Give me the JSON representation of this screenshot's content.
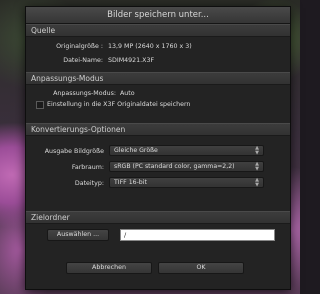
{
  "dialog": {
    "title": "Bilder speichern unter..."
  },
  "quelle": {
    "header": "Quelle",
    "size_label": "Originalgröße :",
    "size_value": "13,9 MP (2640 x 1760 x 3)",
    "filename_label": "Datei-Name:",
    "filename_value": "SDIM4921.X3F"
  },
  "anpassung": {
    "header": "Anpassungs-Modus",
    "mode_label": "Anpassungs-Modus:",
    "mode_value": "Auto",
    "checkbox_label": "Einstellung in die X3F Originaldatei speichern"
  },
  "konvertierung": {
    "header": "Konvertierungs-Optionen",
    "size_label": "Ausgabe Bildgröße",
    "size_value": "Gleiche Größe",
    "colorspace_label": "Farbraum:",
    "colorspace_value": "sRGB (PC standard color, gamma=2,2)",
    "filetype_label": "Dateityp:",
    "filetype_value": "TIFF 16-bit"
  },
  "zielordner": {
    "header": "Zielordner",
    "browse_label": "Auswählen ...",
    "path_value": "/"
  },
  "footer": {
    "cancel_label": "Abbrechen",
    "ok_label": "OK"
  }
}
